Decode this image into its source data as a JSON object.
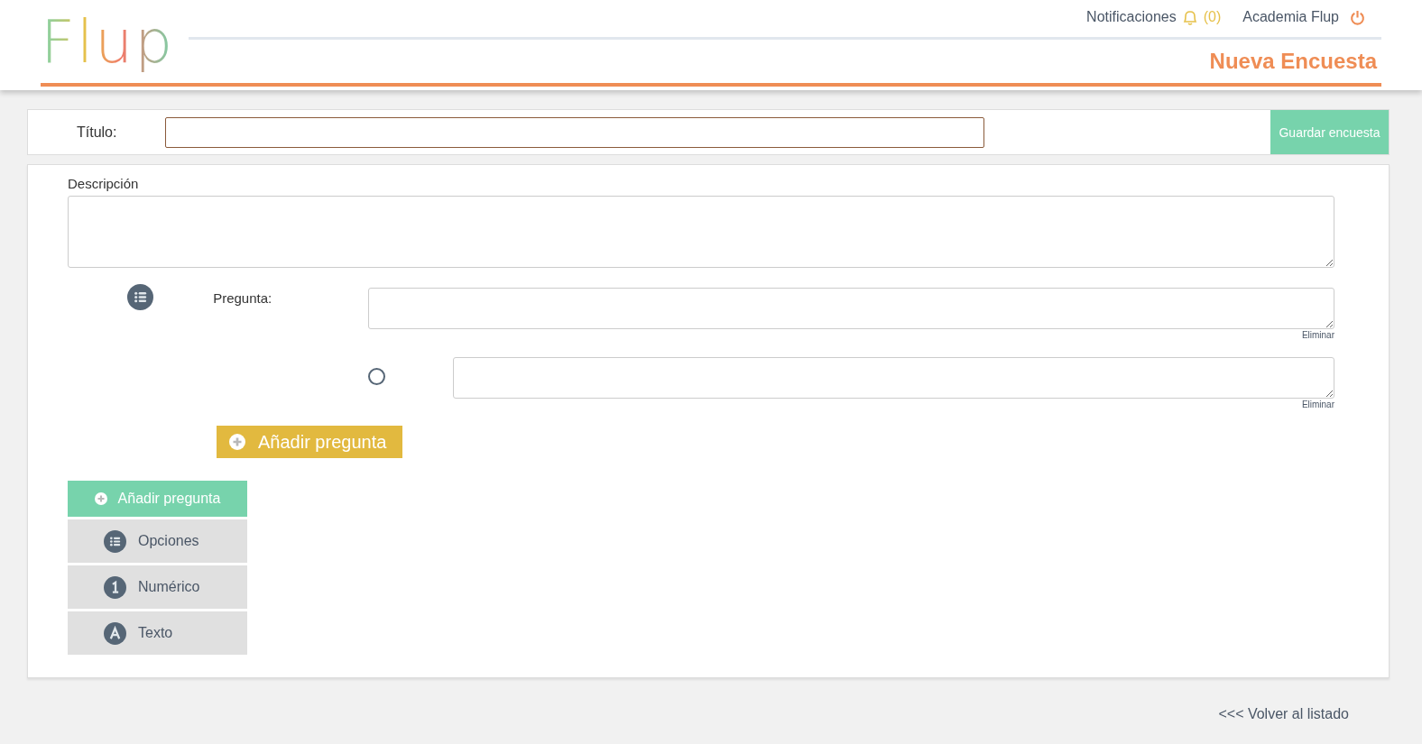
{
  "header": {
    "logo": "Flup",
    "notifications_label": "Notificaciones",
    "notifications_count": "(0)",
    "user": "Academia Flup",
    "page_title": "Nueva Encuesta"
  },
  "title_bar": {
    "label": "Título:",
    "save_button": "Guardar encuesta"
  },
  "description": {
    "label": "Descripción"
  },
  "question": {
    "kind": "options",
    "label": "Pregunta:",
    "delete_link": "Eliminar",
    "options": [
      {
        "selected": false,
        "delete_link": "Eliminar"
      }
    ]
  },
  "add_question_button": "Añadir pregunta",
  "type_menu": {
    "header": "Añadir pregunta",
    "items": [
      {
        "kind": "options",
        "label": "Opciones"
      },
      {
        "kind": "numeric",
        "label": "Numérico"
      },
      {
        "kind": "text",
        "label": "Texto"
      }
    ]
  },
  "back_link": "<<< Volver al listado"
}
